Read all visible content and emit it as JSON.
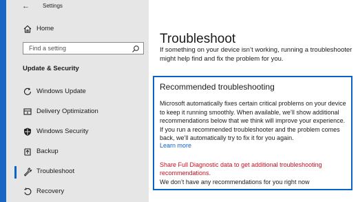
{
  "window": {
    "title": "Settings",
    "back_icon": "back-arrow-icon"
  },
  "sidebar": {
    "home_label": "Home",
    "search_placeholder": "Find a setting",
    "section_title": "Update & Security",
    "items": [
      {
        "label": "Windows Update",
        "icon": "refresh-icon"
      },
      {
        "label": "Delivery Optimization",
        "icon": "delivery-optimization-icon"
      },
      {
        "label": "Windows Security",
        "icon": "shield-icon"
      },
      {
        "label": "Backup",
        "icon": "backup-icon"
      },
      {
        "label": "Troubleshoot",
        "icon": "wrench-icon",
        "active": true
      },
      {
        "label": "Recovery",
        "icon": "recovery-icon"
      }
    ]
  },
  "main": {
    "title": "Troubleshoot",
    "intro": "If something on your device isn’t working, running a troubleshooter might help find and fix the problem for you.",
    "card": {
      "title": "Recommended troubleshooting",
      "body": "Microsoft automatically fixes certain critical problems on your device to keep it running smoothly. When available, we’ll show additional recommendations below that we think will improve your experience. If you run a recommended troubleshooter and the problem comes back, we’ll automatically try to fix it for you again.",
      "learn_more": "Learn more",
      "diagnostic_link": "Share Full Diagnostic data to get additional troubleshooting recommendations.",
      "no_recommendations": "We don’t have any recommendations for you right now"
    }
  },
  "colors": {
    "accent": "#0a63c9",
    "warning_link": "#c50f1f",
    "sidebar_bg": "#e6e6e6",
    "desktop": "#1766c4"
  }
}
